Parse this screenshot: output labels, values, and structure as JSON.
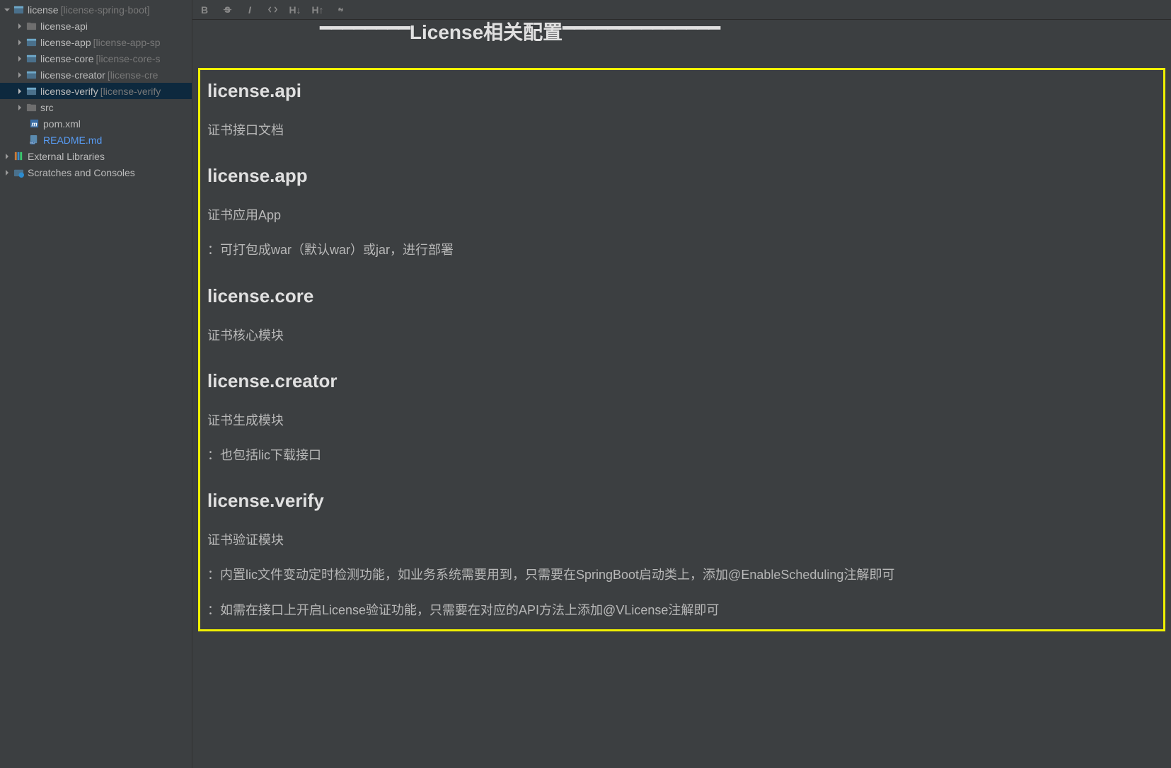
{
  "toolbar": {
    "bold": "B",
    "h_down": "H↓",
    "h_up": "H↑"
  },
  "tree": {
    "root": {
      "label": "license",
      "secondary": "[license-spring-boot]"
    },
    "items": [
      {
        "label": "license-api",
        "secondary": ""
      },
      {
        "label": "license-app",
        "secondary": "[license-app-sp"
      },
      {
        "label": "license-core",
        "secondary": "[license-core-s"
      },
      {
        "label": "license-creator",
        "secondary": "[license-cre"
      },
      {
        "label": "license-verify",
        "secondary": "[license-verify"
      },
      {
        "label": "src",
        "secondary": ""
      }
    ],
    "pom": "pom.xml",
    "readme": "README.md",
    "external": "External Libraries",
    "scratches": "Scratches and Consoles"
  },
  "header_partial": "License相关配置",
  "sections": [
    {
      "heading": "license.api",
      "paras": [
        "证书接口文档"
      ]
    },
    {
      "heading": "license.app",
      "paras": [
        "证书应用App",
        "：可打包成war（默认war）或jar，进行部署"
      ]
    },
    {
      "heading": "license.core",
      "paras": [
        "证书核心模块"
      ]
    },
    {
      "heading": "license.creator",
      "paras": [
        "证书生成模块",
        "：也包括lic下载接口"
      ]
    },
    {
      "heading": "license.verify",
      "paras": [
        "证书验证模块",
        "：内置lic文件变动定时检测功能，如业务系统需要用到，只需要在SpringBoot启动类上，添加@EnableScheduling注解即可",
        "：如需在接口上开启License验证功能，只需要在对应的API方法上添加@VLicense注解即可"
      ]
    }
  ]
}
